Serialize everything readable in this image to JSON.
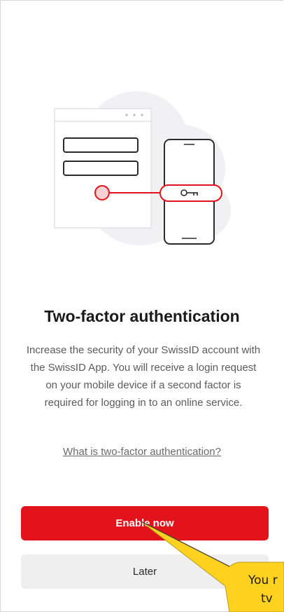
{
  "screen": {
    "title": "Two-factor authentication",
    "description": "Increase the security of your SwissID account with the SwissID App. You will receive a login request on your mobile device if a second factor is required for logging in to an online service.",
    "help_link": "What is two-factor authentication?",
    "primary_button": "Enable now",
    "secondary_button": "Later"
  },
  "callout": {
    "line1": "You r",
    "line2": "tv"
  },
  "colors": {
    "accent": "#e3131b",
    "callout_fill": "#ffd21f",
    "secondary_button_bg": "#efefef"
  },
  "icons": [
    "browser-window-illustration",
    "phone-illustration",
    "key-icon"
  ]
}
